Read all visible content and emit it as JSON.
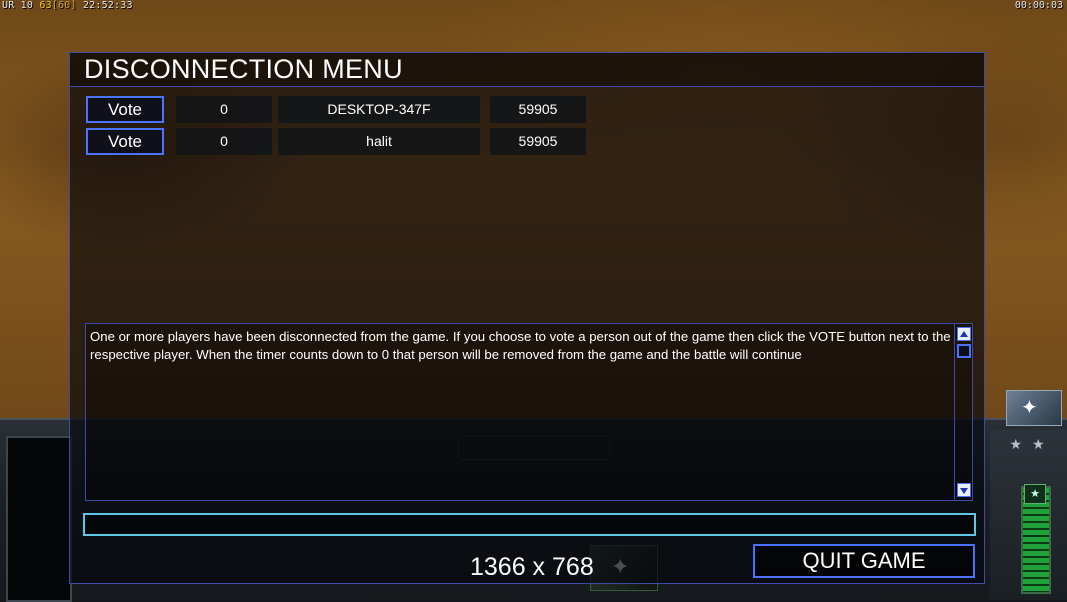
{
  "hud": {
    "left_prefix": "UR 10",
    "left_fps": "63",
    "left_cap": "[60]",
    "left_clock": "22:52:33",
    "right_timer": "00:00:03"
  },
  "menu": {
    "title": "DISCONNECTION MENU",
    "players": [
      {
        "vote_label": "Vote",
        "timer": "0",
        "name": "DESKTOP-347F",
        "ping": "59905"
      },
      {
        "vote_label": "Vote",
        "timer": "0",
        "name": "halit",
        "ping": "59905"
      }
    ],
    "message": "One or more players have been disconnected from the game. If you choose to vote a person out of the game then click the VOTE button next to the respective player. When the timer counts down to 0 that person will be removed from the game and the battle will continue",
    "chat_value": "",
    "resolution": "1366 x 768",
    "quit_label": "QUIT GAME"
  },
  "colors": {
    "menu_border": "#3d4aa8",
    "button_border": "#4a72ff",
    "chat_border": "#5fc6e6",
    "fps_highlight": "#f0d000"
  },
  "icons": {
    "scroll_up": "triangle-up",
    "scroll_down": "triangle-down",
    "general_portrait": "satellite",
    "rank": "star"
  }
}
